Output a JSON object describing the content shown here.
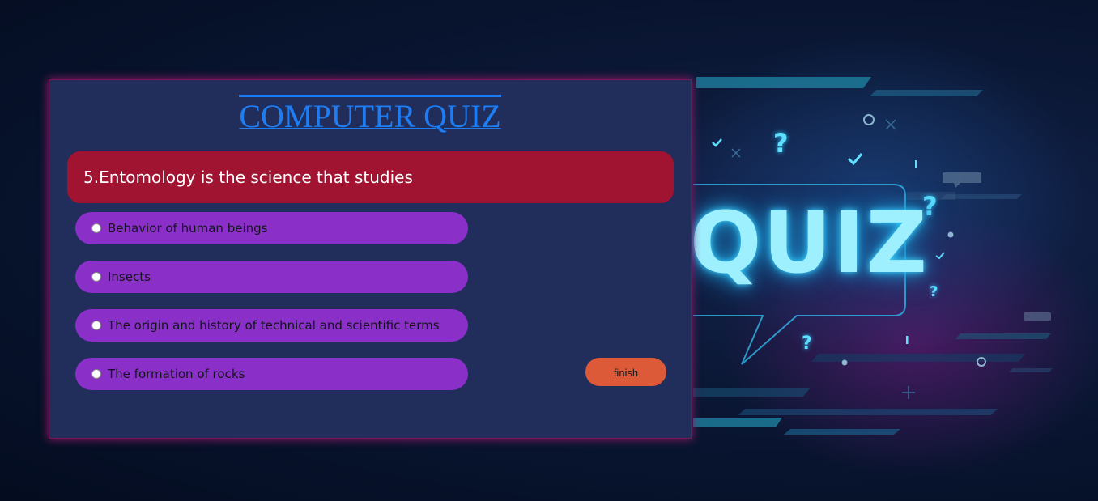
{
  "page": {
    "title": "COMPUTER QUIZ",
    "title_color": "#1e7df2"
  },
  "background": {
    "art_word": "QUIZ",
    "accent_color": "#3fd2ff",
    "decorations": [
      "question-mark-icon",
      "check-icon",
      "circle-icon",
      "plus-icon",
      "cross-icon",
      "exclamation-icon"
    ]
  },
  "question": {
    "text": "5.Entomology is the science that studies",
    "bg_color": "#a01432"
  },
  "options": [
    {
      "label": "Behavior of human beings",
      "selected": false
    },
    {
      "label": "Insects",
      "selected": false
    },
    {
      "label": "The origin and history of technical and scientific terms",
      "selected": false
    },
    {
      "label": "The formation of rocks",
      "selected": false
    }
  ],
  "option_color": "#8a2fc8",
  "finish": {
    "label": "finish",
    "color": "#dc5a38"
  }
}
